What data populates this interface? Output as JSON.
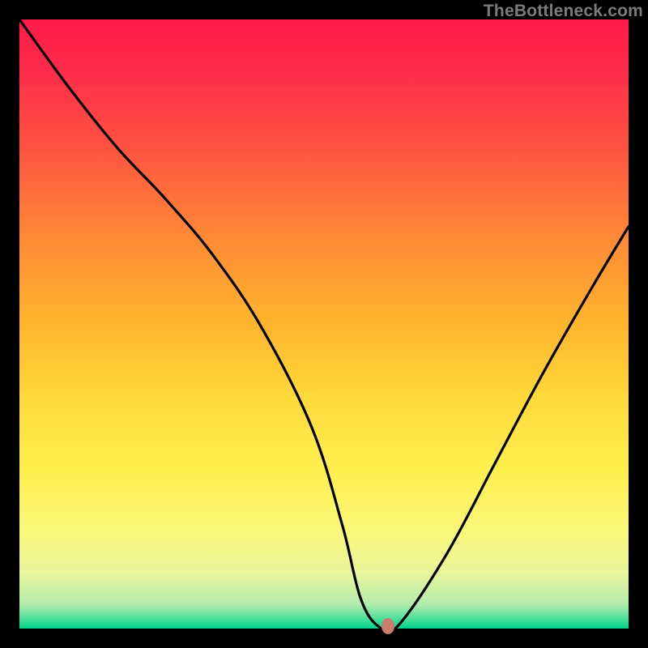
{
  "watermark": "TheBottleneck.com",
  "chart_data": {
    "type": "line",
    "title": "",
    "xlabel": "",
    "ylabel": "",
    "xlim": [
      0,
      100
    ],
    "ylim": [
      0,
      100
    ],
    "series": [
      {
        "name": "curve",
        "x": [
          0,
          8,
          16,
          24,
          32,
          40,
          48,
          53,
          56,
          59,
          62,
          70,
          78,
          86,
          94,
          100
        ],
        "y": [
          100,
          89,
          79,
          70.5,
          61,
          49,
          33,
          17,
          5,
          0.3,
          0.3,
          12,
          27,
          42,
          56,
          66
        ]
      }
    ],
    "marker": {
      "x": 60.5,
      "y": 0.35
    },
    "gradient_stops": [
      {
        "pos": 0,
        "color": "#ff1a4a"
      },
      {
        "pos": 50,
        "color": "#ffb52d"
      },
      {
        "pos": 100,
        "color": "#00d48a"
      }
    ]
  }
}
